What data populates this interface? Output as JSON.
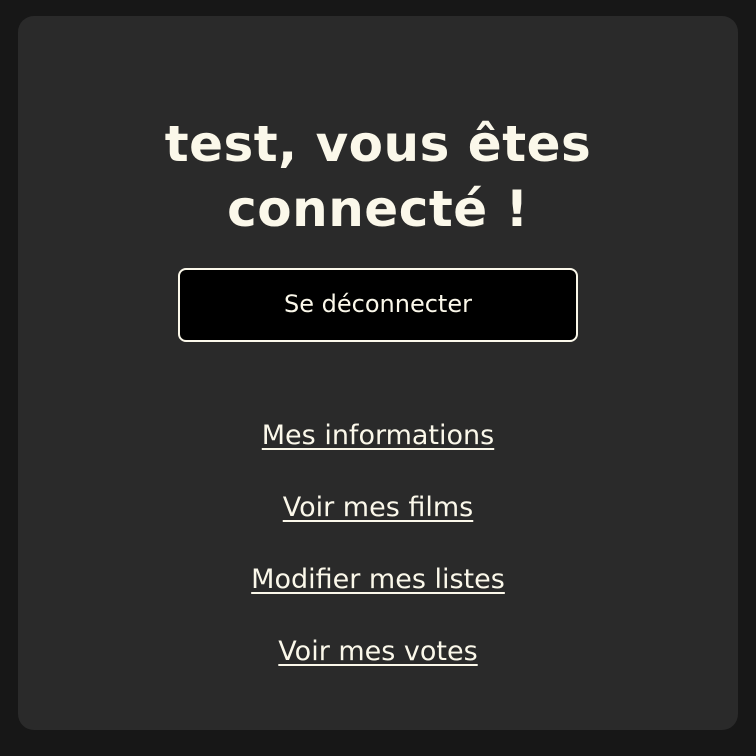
{
  "header": {
    "title_line1": "test, vous êtes",
    "title_line2": "connecté !"
  },
  "actions": {
    "logout_label": "Se déconnecter"
  },
  "links": [
    {
      "label": "Mes informations"
    },
    {
      "label": "Voir mes films"
    },
    {
      "label": "Modifier mes listes"
    },
    {
      "label": "Voir mes votes"
    }
  ],
  "colors": {
    "page_background": "#171717",
    "card_background": "#2a2a2a",
    "text": "#fbf8ea",
    "button_background": "#000000"
  }
}
